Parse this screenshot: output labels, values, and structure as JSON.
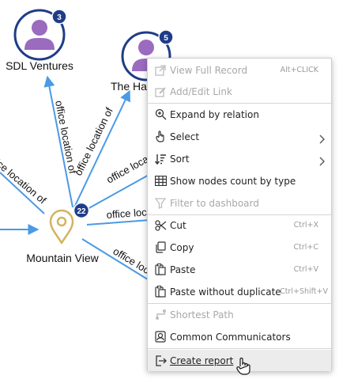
{
  "graph": {
    "edge_labels": [
      "office location of",
      "office location of",
      "office location of",
      "office location of",
      "office location of",
      "office location of",
      "office location of"
    ],
    "nodes": {
      "sdl": {
        "label": "SDL Ventures",
        "badge": "3",
        "icon": "person-icon"
      },
      "hawk": {
        "label": "The Ha",
        "badge": "5",
        "icon": "person-icon"
      },
      "mountain": {
        "label": "Mountain View",
        "badge": "22",
        "icon": "location-pin-icon"
      }
    },
    "colors": {
      "edge": "#4a9ae6",
      "node_ring": "#1f3c88",
      "badge": "#1f3c88",
      "person": "#9b6bbf",
      "pin": "#d4b35e"
    }
  },
  "context_menu": {
    "items": [
      {
        "id": "view-full-record",
        "label": "View Full Record",
        "shortcut": "Alt+CLICK",
        "icon": "external-link-icon",
        "disabled": true
      },
      {
        "id": "add-edit-link",
        "label": "Add/Edit Link",
        "shortcut": "",
        "icon": "edit-link-icon",
        "disabled": true
      },
      {
        "id": "expand-by-relation",
        "label": "Expand by relation",
        "shortcut": "",
        "icon": "expand-icon",
        "disabled": false
      },
      {
        "id": "select",
        "label": "Select",
        "shortcut": "",
        "icon": "pointer-hand-icon",
        "disabled": false,
        "submenu": true
      },
      {
        "id": "sort",
        "label": "Sort",
        "shortcut": "",
        "icon": "sort-icon",
        "disabled": false,
        "submenu": true
      },
      {
        "id": "show-nodes-count",
        "label": "Show nodes count by type",
        "shortcut": "",
        "icon": "grid-icon",
        "disabled": false
      },
      {
        "id": "filter-to-dashboard",
        "label": "Filter to dashboard",
        "shortcut": "",
        "icon": "filter-icon",
        "disabled": true
      },
      {
        "id": "cut",
        "label": "Cut",
        "shortcut": "Ctrl+X",
        "icon": "scissors-icon",
        "disabled": false
      },
      {
        "id": "copy",
        "label": "Copy",
        "shortcut": "Ctrl+C",
        "icon": "copy-icon",
        "disabled": false
      },
      {
        "id": "paste",
        "label": "Paste",
        "shortcut": "Ctrl+V",
        "icon": "paste-icon",
        "disabled": false
      },
      {
        "id": "paste-without-duplicate",
        "label": "Paste without duplicate",
        "shortcut": "Ctrl+Shift+V",
        "icon": "paste-icon",
        "disabled": false
      },
      {
        "id": "shortest-path",
        "label": "Shortest Path",
        "shortcut": "",
        "icon": "path-icon",
        "disabled": true
      },
      {
        "id": "common-communicators",
        "label": "Common Communicators",
        "shortcut": "",
        "icon": "communicators-icon",
        "disabled": false
      },
      {
        "id": "create-report",
        "label": "Create report",
        "shortcut": "",
        "icon": "report-export-icon",
        "disabled": false,
        "highlighted": true
      }
    ]
  }
}
